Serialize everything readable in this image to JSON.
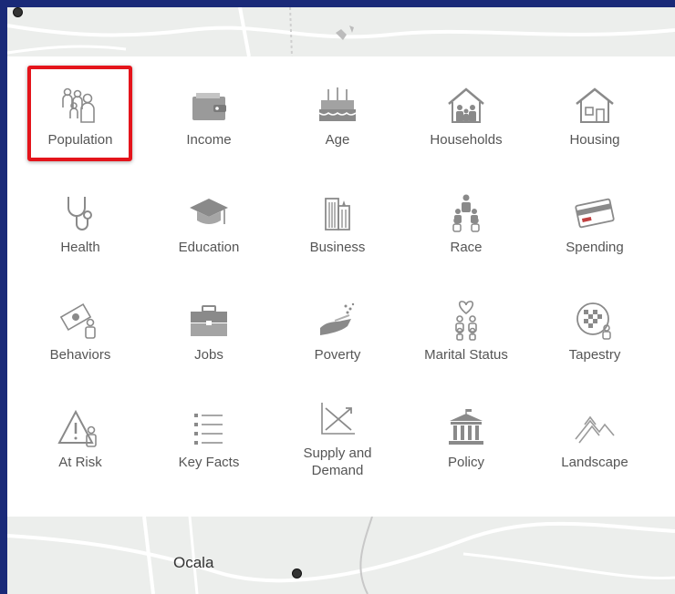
{
  "panel": {
    "items": [
      {
        "label": "Population",
        "icon": "population-icon"
      },
      {
        "label": "Income",
        "icon": "wallet-icon"
      },
      {
        "label": "Age",
        "icon": "birthday-cake-icon"
      },
      {
        "label": "Households",
        "icon": "household-icon"
      },
      {
        "label": "Housing",
        "icon": "house-icon"
      },
      {
        "label": "Health",
        "icon": "stethoscope-icon"
      },
      {
        "label": "Education",
        "icon": "graduation-cap-icon"
      },
      {
        "label": "Business",
        "icon": "buildings-icon"
      },
      {
        "label": "Race",
        "icon": "people-group-icon"
      },
      {
        "label": "Spending",
        "icon": "credit-card-icon"
      },
      {
        "label": "Behaviors",
        "icon": "money-person-icon"
      },
      {
        "label": "Jobs",
        "icon": "briefcase-icon"
      },
      {
        "label": "Poverty",
        "icon": "open-hand-icon"
      },
      {
        "label": "Marital Status",
        "icon": "couple-heart-icon"
      },
      {
        "label": "Tapestry",
        "icon": "tapestry-globe-icon"
      },
      {
        "label": "At Risk",
        "icon": "warning-person-icon"
      },
      {
        "label": "Key Facts",
        "icon": "bullet-list-icon"
      },
      {
        "label": "Supply and Demand",
        "icon": "supply-demand-chart-icon"
      },
      {
        "label": "Policy",
        "icon": "government-building-icon"
      },
      {
        "label": "Landscape",
        "icon": "mountains-icon"
      }
    ],
    "selected": "Population",
    "highlight_color": "#e4141b"
  },
  "map": {
    "place_label": "Ocala"
  },
  "colors": {
    "background": "#1a2a78",
    "icon": "#8a8a8a",
    "label": "#555555"
  }
}
